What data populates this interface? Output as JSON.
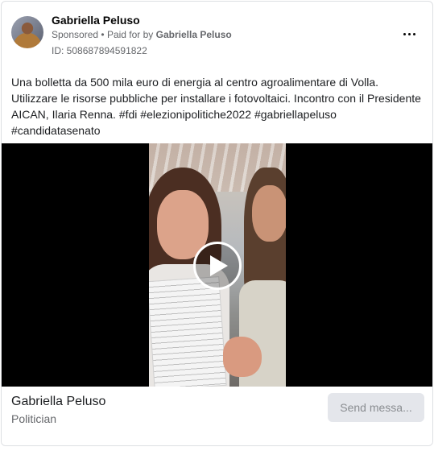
{
  "post": {
    "author": "Gabriella Peluso",
    "sponsored": "Sponsored",
    "paid_prefix": "Paid for by",
    "paid_by": "Gabriella Peluso",
    "ad_id": "ID: 508687894591822",
    "text": "Una bolletta da 500 mila euro di energia al centro agroalimentare di Volla.\nUtilizzare le risorse pubbliche per installare i fotovoltaici. Incontro con il Presidente AICAN, Ilaria Renna. #fdi #elezionipolitiche2022 #gabriellapeluso\n#candidatasenato"
  },
  "video": {
    "play_icon": "play-icon"
  },
  "footer": {
    "page_name": "Gabriella Peluso",
    "category": "Politician",
    "cta_label": "Send messa..."
  },
  "icons": {
    "more": "more-horizontal-icon"
  },
  "colors": {
    "text_primary": "#050505",
    "text_secondary": "#65676b",
    "button_bg": "#e4e6eb",
    "video_bg": "#000000"
  }
}
